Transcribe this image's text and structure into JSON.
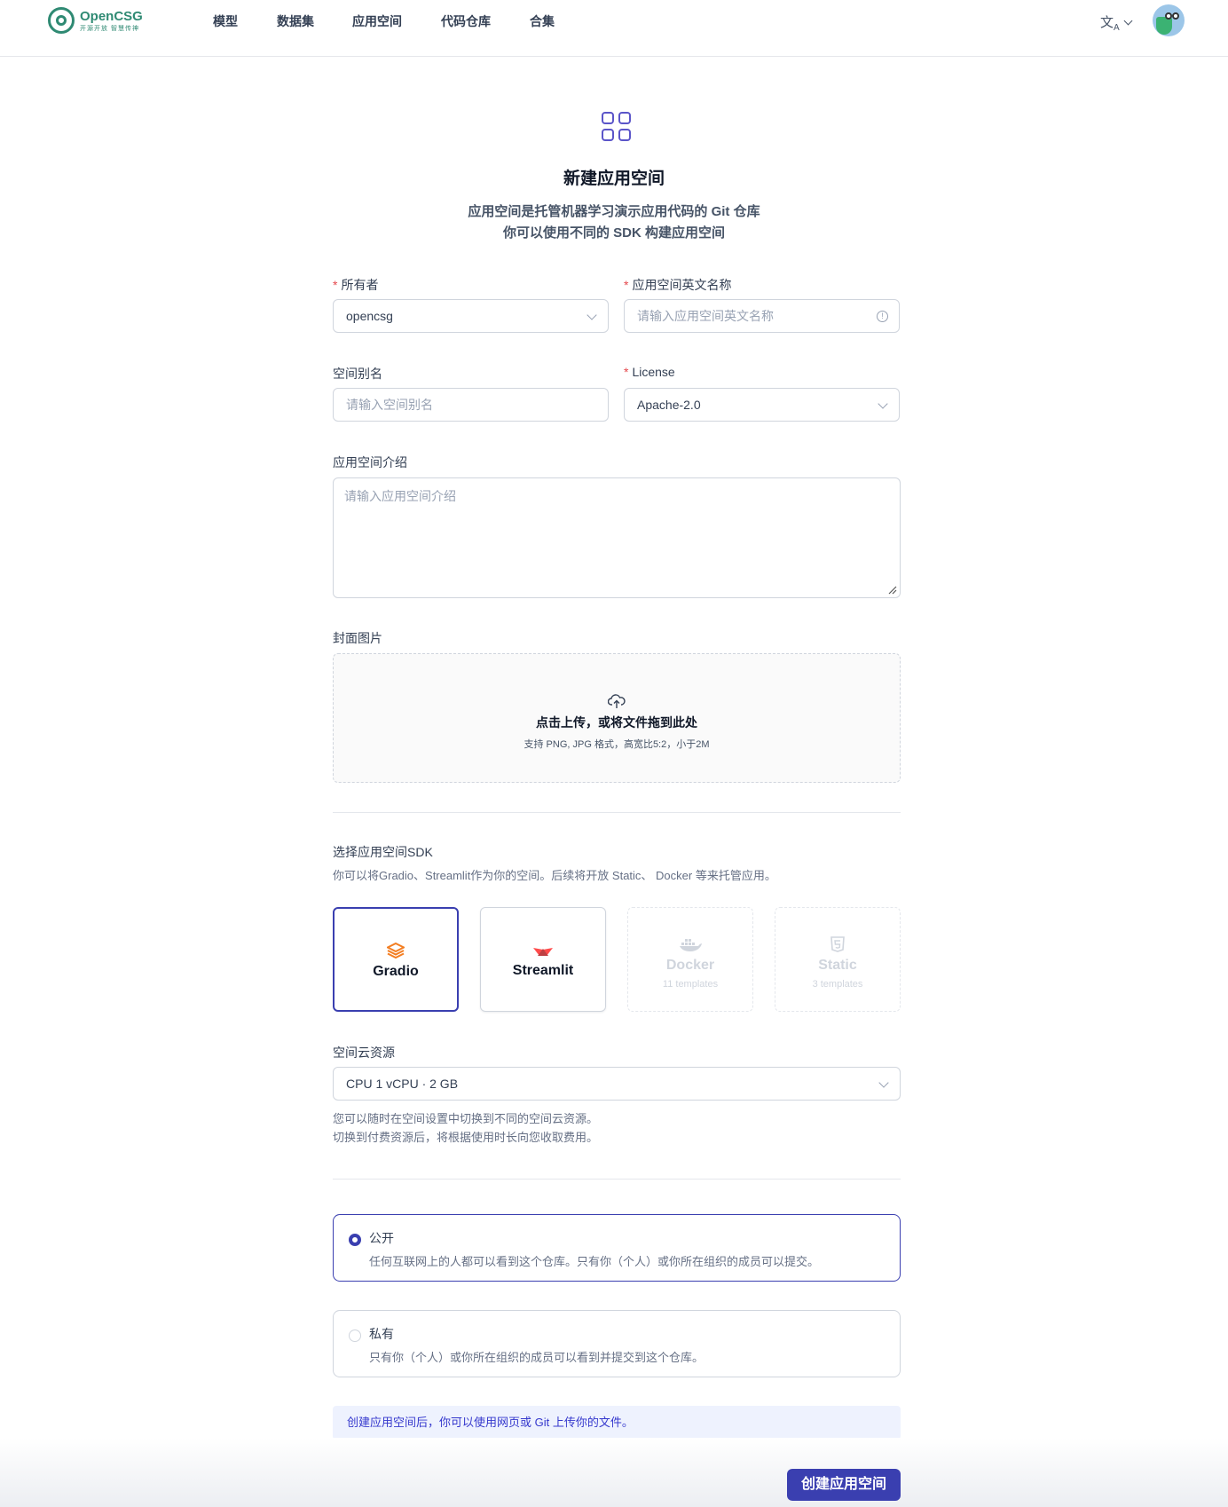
{
  "header": {
    "logo_name": "OpenCSG",
    "logo_tagline": "开源开放 智慧传神",
    "nav": [
      "模型",
      "数据集",
      "应用空间",
      "代码仓库",
      "合集"
    ],
    "language_icon": "translate-icon"
  },
  "hero": {
    "icon": "grid-icon",
    "title": "新建应用空间",
    "subtitle_line1": "应用空间是托管机器学习演示应用代码的 Git 仓库",
    "subtitle_line2": "你可以使用不同的 SDK 构建应用空间"
  },
  "form": {
    "owner": {
      "label": "所有者",
      "value": "opencsg"
    },
    "name": {
      "label": "应用空间英文名称",
      "placeholder": "请输入应用空间英文名称"
    },
    "alias": {
      "label": "空间别名",
      "placeholder": "请输入空间别名"
    },
    "license": {
      "label": "License",
      "value": "Apache-2.0"
    },
    "description": {
      "label": "应用空间介绍",
      "placeholder": "请输入应用空间介绍"
    },
    "cover": {
      "label": "封面图片",
      "upload_text": "点击上传，或将文件拖到此处",
      "upload_hint": "支持 PNG, JPG 格式，高宽比5:2，小于2M"
    },
    "sdk": {
      "label": "选择应用空间SDK",
      "hint": "你可以将Gradio、Streamlit作为你的空间。后续将开放 Static、 Docker 等来托管应用。",
      "options": [
        {
          "name": "Gradio",
          "icon": "gradio-icon",
          "selected": true
        },
        {
          "name": "Streamlit",
          "icon": "streamlit-icon",
          "selected": false
        },
        {
          "name": "Docker",
          "templates": "11 templates",
          "icon": "docker-icon",
          "disabled": true
        },
        {
          "name": "Static",
          "templates": "3 templates",
          "icon": "html5-icon",
          "disabled": true
        }
      ]
    },
    "resource": {
      "label": "空间云资源",
      "value": "CPU 1 vCPU · 2 GB",
      "hint_line1": "您可以随时在空间设置中切换到不同的空间云资源。",
      "hint_line2": "切换到付费资源后，将根据使用时长向您收取费用。"
    },
    "visibility": {
      "public": {
        "title": "公开",
        "desc": "任何互联网上的人都可以看到这个仓库。只有你（个人）或你所在组织的成员可以提交。",
        "selected": true
      },
      "private": {
        "title": "私有",
        "desc": "只有你（个人）或你所在组织的成员可以看到并提交到这个仓库。",
        "selected": false
      }
    },
    "notice": "创建应用空间后，你可以使用网页或 Git 上传你的文件。",
    "submit_label": "创建应用空间"
  },
  "colors": {
    "accent": "#3a3fb0",
    "brand": "#2f8a73",
    "required": "#e5484d"
  }
}
